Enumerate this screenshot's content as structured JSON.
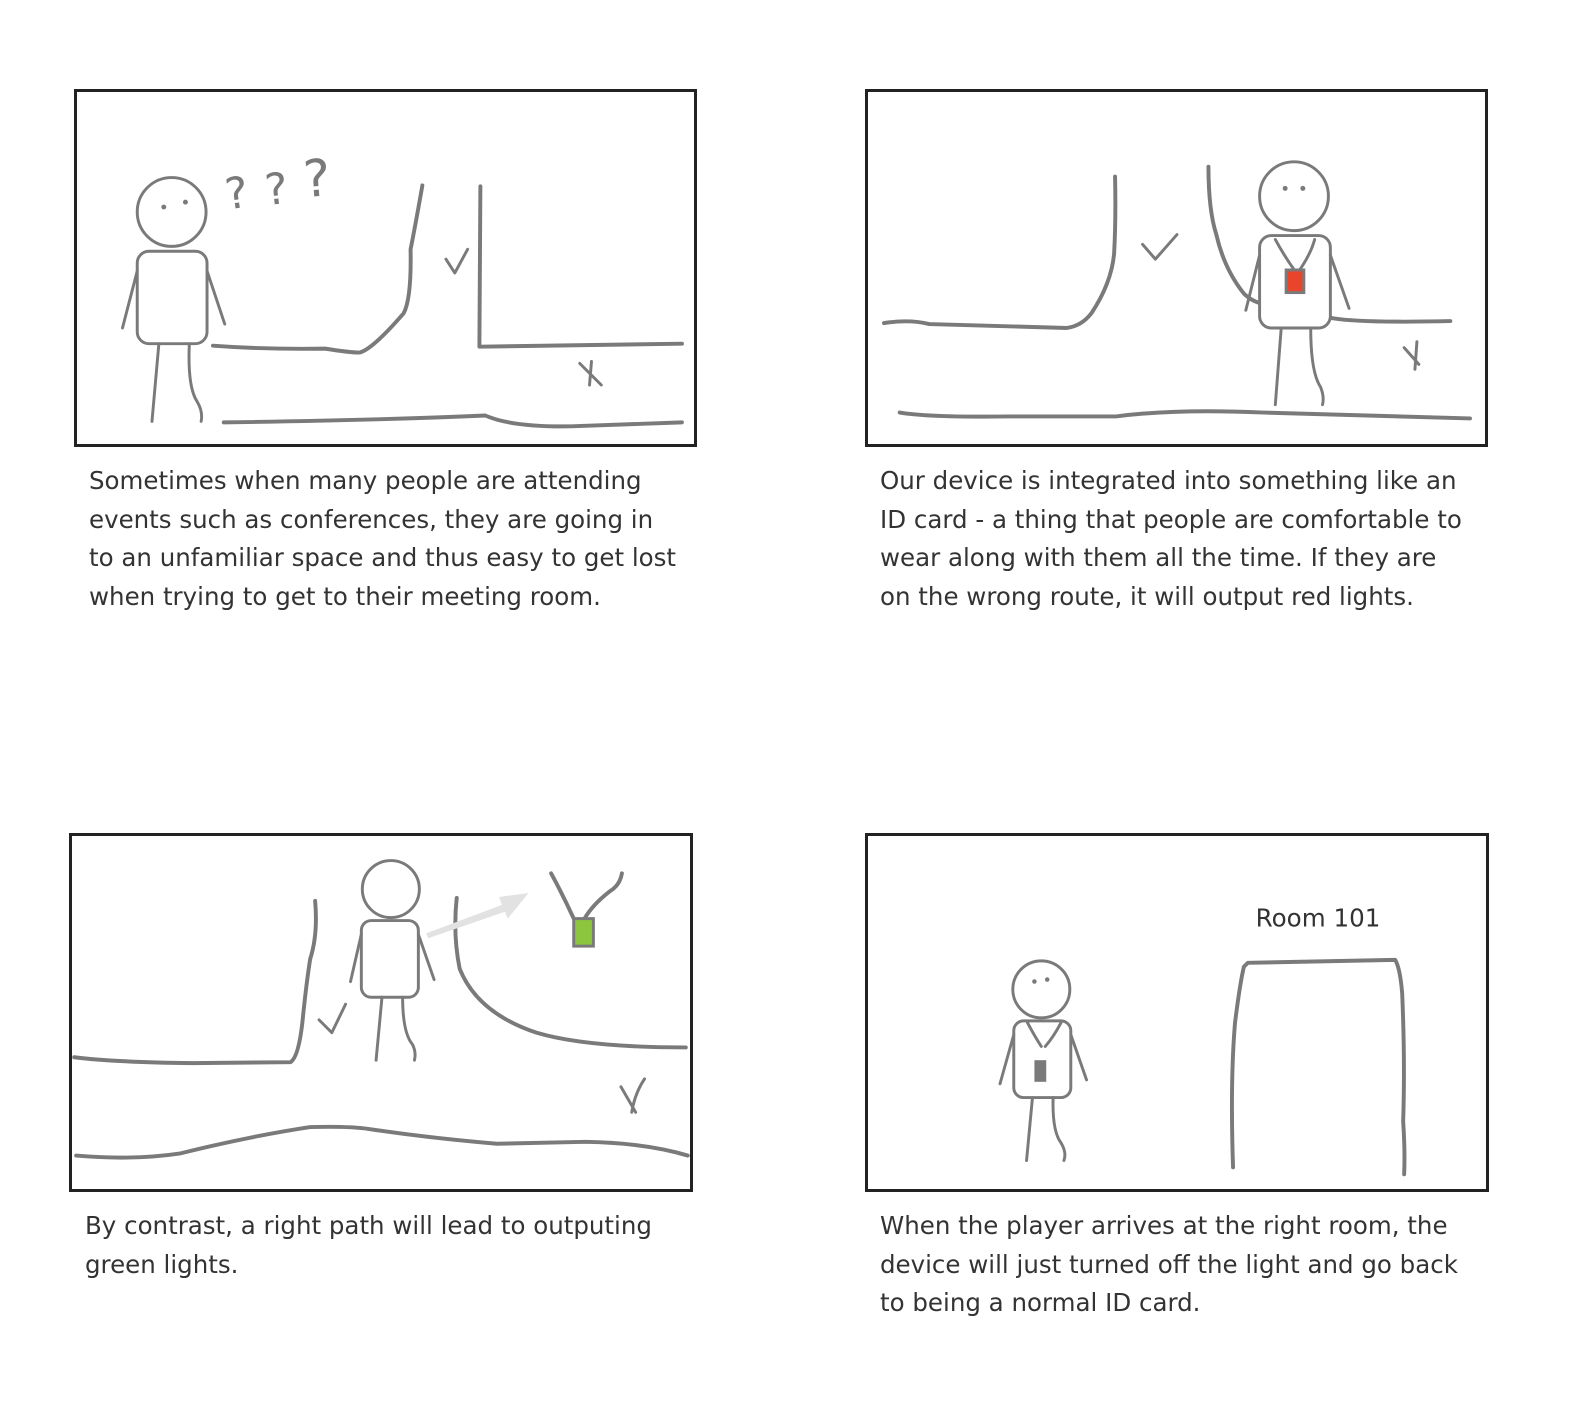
{
  "panels": [
    {
      "caption_lines": [
        "Sometimes when many people are attending",
        "events such as conferences, they are going in",
        "to an unfamiliar space and thus easy to get lost",
        "when trying to get to their meeting room."
      ],
      "question_marks": [
        "?",
        "?",
        "?"
      ]
    },
    {
      "caption_lines": [
        "Our device is integrated into something like an",
        "ID card - a thing that people are comfortable to",
        "wear along with them all the time. If they are",
        "on the wrong route, it will output red lights."
      ],
      "badge_color": "#e8452c"
    },
    {
      "caption_lines": [
        "By contrast, a right path will lead to outputing",
        "green lights."
      ],
      "badge_color": "#8cc63f"
    },
    {
      "caption_lines": [
        "When the player arrives at the right room, the",
        "device will just turned off the light and go back",
        "to being a normal ID card."
      ],
      "room_label": "Room 101",
      "badge_color": "#7a7a7a"
    }
  ],
  "colors": {
    "sketch_stroke": "#7a7a7a",
    "frame": "#222222",
    "text": "#333333"
  }
}
